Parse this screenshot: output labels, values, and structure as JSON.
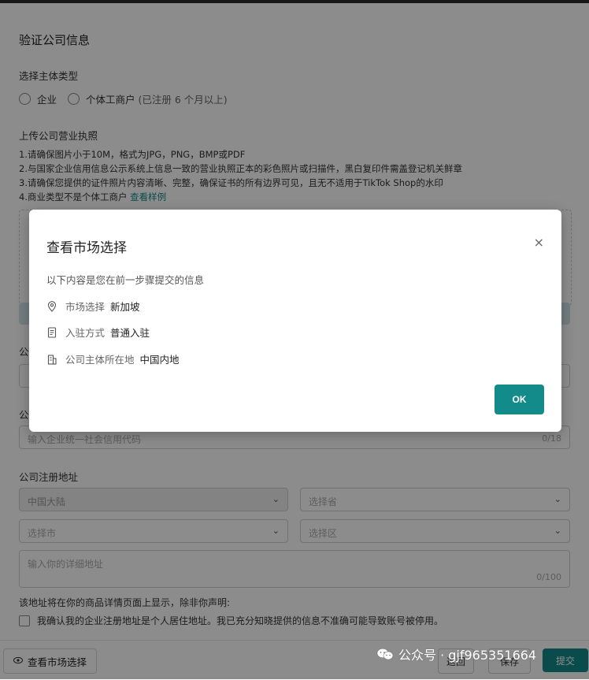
{
  "form": {
    "title": "验证公司信息",
    "entity_type_label": "选择主体类型",
    "entity_options": [
      "企业",
      "个体工商户"
    ],
    "entity_option_note": "(已注册 6 个月以上)",
    "upload_label": "上传公司营业执照",
    "requirements": [
      "1.请确保图片小于10M，格式为JPG，PNG，BMP或PDF",
      "2.与国家企业信用信息公示系统上信息一致的营业执照正本的彩色照片或扫描件，黑白复印件需盖登记机关鲜章",
      "3.请确保您提供的证件照片内容清晰、完整，确保证书的所有边界可见，且无不适用于TikTok Shop的水印",
      "4.商业类型不是个体工商户"
    ],
    "sample_link": "查看样例",
    "cut_label_1": "公",
    "cut_label_2": "公",
    "credit_code_placeholder": "输入企业统一社会信用代码",
    "credit_code_counter": "0/18",
    "address_label": "公司注册地址",
    "country_value": "中国大陆",
    "province_placeholder": "选择省",
    "city_placeholder": "选择市",
    "district_placeholder": "选择区",
    "detail_placeholder": "输入你的详细地址",
    "detail_counter": "0/100",
    "address_note": "该地址将在你的商品详情页面上显示，除非你声明:",
    "residence_check": "我确认我的企业注册地址是个人居住地址。我已充分知晓提供的信息不准确可能导致账号被停用。"
  },
  "footer": {
    "view_market": "查看市场选择",
    "back": "返回",
    "save": "保存",
    "submit": "提交"
  },
  "watermark": {
    "text": "公众号 · gjf965351664"
  },
  "modal": {
    "title": "查看市场选择",
    "description": "以下内容是您在前一步骤提交的信息",
    "rows": [
      {
        "icon": "location-pin-icon",
        "label": "市场选择",
        "value": "新加坡"
      },
      {
        "icon": "document-icon",
        "label": "入驻方式",
        "value": "普通入驻"
      },
      {
        "icon": "building-icon",
        "label": "公司主体所在地",
        "value": "中国内地"
      }
    ],
    "ok_label": "OK",
    "close_glyph": "×"
  },
  "colors": {
    "accent": "#138b8a",
    "overlay": "rgba(0,0,0,0.45)"
  }
}
